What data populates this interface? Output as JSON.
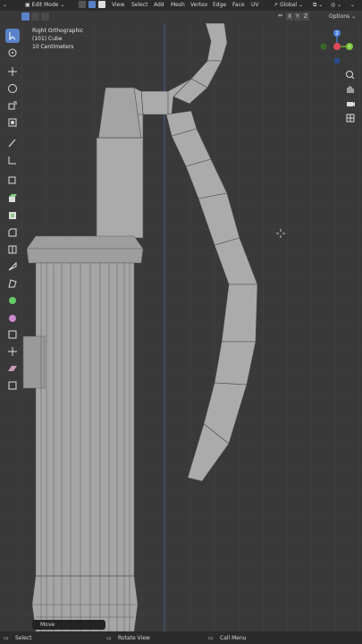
{
  "header": {
    "mode": "Edit Mode",
    "menus": [
      "View",
      "Select",
      "Add",
      "Mesh",
      "Vertex",
      "Edge",
      "Face",
      "UV"
    ],
    "orientation": "Global",
    "axes": [
      "X",
      "Y",
      "Z"
    ],
    "options": "Options"
  },
  "overlay": {
    "view_name": "Right Orthographic",
    "object": "(101) Cube",
    "scale": "10 Centimeters"
  },
  "gizmo": {
    "z": "Z",
    "y": "Y"
  },
  "operator": {
    "name": "Move"
  },
  "status": {
    "select": "Select",
    "rotate": "Rotate View",
    "menu": "Call Menu"
  },
  "colors": {
    "x_axis": "#e04a5a",
    "y_axis": "#7ac43a",
    "z_axis": "#4a80e0",
    "active_tool": "#5a82c8",
    "mesh_fill": "#a9a9a9",
    "grid_bg": "#393939"
  },
  "icons": [
    "menu-icon",
    "edit-mode-icon",
    "vertex-select-icon",
    "edge-select-icon",
    "face-select-icon",
    "select-box-icon",
    "cursor-icon",
    "move-icon",
    "rotate-icon",
    "scale-icon",
    "transform-icon",
    "annotate-icon",
    "measure-icon",
    "add-cube-icon",
    "extrude-icon",
    "inset-icon",
    "bevel-icon",
    "loop-cut-icon",
    "knife-icon",
    "poly-build-icon",
    "spin-icon",
    "smooth-icon",
    "edge-slide-icon",
    "shrink-fatten-icon",
    "shear-icon",
    "rip-icon",
    "zoom-icon",
    "hand-pan-icon",
    "camera-icon",
    "grid-icon"
  ]
}
